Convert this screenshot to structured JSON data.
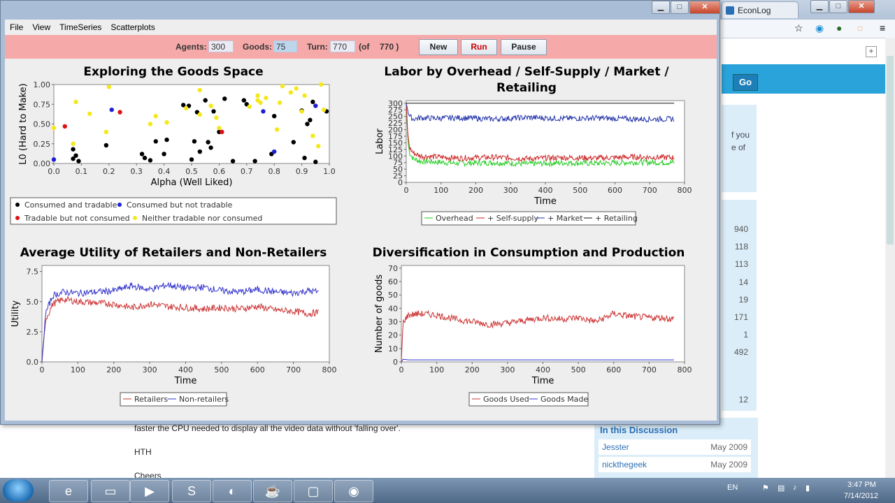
{
  "browser": {
    "tab_title": "EconLog",
    "go_label": "Go",
    "side_text_1": "f you",
    "side_text_2": "e of",
    "counts": [
      "940",
      "118",
      "113",
      "14",
      "19",
      "171",
      "1",
      "492",
      "12"
    ],
    "post_line": "faster the CPU needed to display all the video data without 'falling over'.",
    "post_hth": "HTH",
    "post_cheers": "Cheers",
    "discussion_title": "In this Discussion",
    "discussion_rows": [
      {
        "user": "Jesster",
        "date": "May 2009"
      },
      {
        "user": "nickthegeek",
        "date": "May 2009"
      }
    ]
  },
  "app": {
    "menu": [
      "File",
      "View",
      "TimeSeries",
      "Scatterplots"
    ],
    "controls": {
      "agents_label": "Agents:",
      "agents_value": "300",
      "goods_label": "Goods:",
      "goods_value": "75",
      "turn_label": "Turn:",
      "turn_value": "770",
      "of_label": "(of",
      "of_value": "770 )",
      "new_label": "New",
      "run_label": "Run",
      "pause_label": "Pause"
    },
    "colors": {
      "control_bar": "#f6a9a9",
      "run_text": "#cc0000"
    }
  },
  "taskbar": {
    "lang": "EN",
    "time": "3:47 PM",
    "date": "7/14/2012",
    "apps": [
      "ie-icon",
      "folder-icon",
      "media-player-icon",
      "skype-icon",
      "globe-icon",
      "java-icon",
      "window-icon",
      "chrome-icon"
    ]
  },
  "chart_data": [
    {
      "type": "scatter",
      "title": "Exploring the Goods Space",
      "xlabel": "Alpha (Well Liked)",
      "ylabel": "L0 (Hard to Make)",
      "xlim": [
        0,
        1.0
      ],
      "ylim": [
        0,
        1.0
      ],
      "xticks": [
        "0.0",
        "0.1",
        "0.2",
        "0.3",
        "0.4",
        "0.5",
        "0.6",
        "0.7",
        "0.8",
        "0.9",
        "1.0"
      ],
      "yticks": [
        "0.00",
        "0.25",
        "0.50",
        "0.75",
        "1.00"
      ],
      "legend_position": "bottom",
      "series": [
        {
          "name": "Consumed and tradable",
          "color": "#000000",
          "points": [
            [
              0.07,
              0.18
            ],
            [
              0.07,
              0.06
            ],
            [
              0.08,
              0.1
            ],
            [
              0.09,
              0.03
            ],
            [
              0.19,
              0.23
            ],
            [
              0.32,
              0.12
            ],
            [
              0.33,
              0.07
            ],
            [
              0.35,
              0.04
            ],
            [
              0.37,
              0.28
            ],
            [
              0.4,
              0.12
            ],
            [
              0.41,
              0.3
            ],
            [
              0.47,
              0.74
            ],
            [
              0.49,
              0.73
            ],
            [
              0.5,
              0.05
            ],
            [
              0.51,
              0.28
            ],
            [
              0.52,
              0.65
            ],
            [
              0.53,
              0.15
            ],
            [
              0.55,
              0.8
            ],
            [
              0.56,
              0.27
            ],
            [
              0.57,
              0.2
            ],
            [
              0.58,
              0.66
            ],
            [
              0.6,
              0.4
            ],
            [
              0.62,
              0.82
            ],
            [
              0.65,
              0.03
            ],
            [
              0.69,
              0.8
            ],
            [
              0.7,
              0.75
            ],
            [
              0.73,
              0.03
            ],
            [
              0.79,
              0.12
            ],
            [
              0.8,
              0.6
            ],
            [
              0.87,
              0.27
            ],
            [
              0.9,
              0.67
            ],
            [
              0.91,
              0.07
            ],
            [
              0.92,
              0.5
            ],
            [
              0.93,
              0.55
            ],
            [
              0.94,
              0.78
            ],
            [
              0.95,
              0.02
            ],
            [
              0.99,
              0.66
            ]
          ]
        },
        {
          "name": "Consumed but not tradable",
          "color": "#1f1fd6",
          "points": [
            [
              0.0,
              0.05
            ],
            [
              0.21,
              0.68
            ],
            [
              0.76,
              0.66
            ],
            [
              0.8,
              0.15
            ],
            [
              0.95,
              0.73
            ]
          ]
        },
        {
          "name": "Tradable but not consumed",
          "color": "#dd1111",
          "points": [
            [
              0.04,
              0.47
            ],
            [
              0.24,
              0.65
            ],
            [
              0.61,
              0.4
            ]
          ]
        },
        {
          "name": "Neither tradable nor consumed",
          "color": "#f5e81a",
          "points": [
            [
              0.0,
              0.45
            ],
            [
              0.07,
              0.25
            ],
            [
              0.08,
              0.78
            ],
            [
              0.13,
              0.63
            ],
            [
              0.19,
              0.4
            ],
            [
              0.2,
              0.97
            ],
            [
              0.35,
              0.5
            ],
            [
              0.37,
              0.6
            ],
            [
              0.41,
              0.52
            ],
            [
              0.48,
              0.7
            ],
            [
              0.53,
              0.93
            ],
            [
              0.53,
              0.62
            ],
            [
              0.57,
              0.73
            ],
            [
              0.59,
              0.58
            ],
            [
              0.6,
              0.45
            ],
            [
              0.71,
              0.72
            ],
            [
              0.74,
              0.8
            ],
            [
              0.74,
              0.86
            ],
            [
              0.75,
              0.77
            ],
            [
              0.77,
              0.83
            ],
            [
              0.81,
              0.43
            ],
            [
              0.82,
              0.77
            ],
            [
              0.83,
              0.98
            ],
            [
              0.86,
              0.9
            ],
            [
              0.88,
              0.95
            ],
            [
              0.9,
              0.66
            ],
            [
              0.91,
              0.86
            ],
            [
              0.94,
              0.35
            ],
            [
              0.96,
              0.22
            ],
            [
              0.97,
              1.0
            ],
            [
              0.98,
              0.68
            ]
          ]
        }
      ]
    },
    {
      "type": "line",
      "title": "Labor by Overhead / Self-Supply / Market / Retailing",
      "xlabel": "Time",
      "ylabel": "Labor",
      "xlim": [
        0,
        800
      ],
      "ylim": [
        0,
        310
      ],
      "xticks": [
        "0",
        "100",
        "200",
        "300",
        "400",
        "500",
        "600",
        "700",
        "800"
      ],
      "yticks": [
        "0",
        "25",
        "50",
        "75",
        "100",
        "125",
        "150",
        "175",
        "200",
        "225",
        "250",
        "275",
        "300"
      ],
      "legend_position": "bottom",
      "series": [
        {
          "name": "Overhead",
          "color": "#22cc22",
          "x": [
            0,
            5,
            10,
            20,
            40,
            80,
            150,
            250,
            350,
            450,
            550,
            650,
            770
          ],
          "y": [
            300,
            150,
            110,
            90,
            80,
            78,
            72,
            75,
            70,
            74,
            72,
            76,
            75
          ]
        },
        {
          "name": "+ Self-supply",
          "color": "#cc2222",
          "x": [
            0,
            5,
            10,
            20,
            40,
            80,
            150,
            250,
            350,
            450,
            550,
            650,
            770
          ],
          "y": [
            300,
            170,
            130,
            112,
            100,
            97,
            92,
            95,
            90,
            94,
            92,
            96,
            94
          ]
        },
        {
          "name": "+ Market",
          "color": "#2233aa",
          "x": [
            0,
            5,
            10,
            20,
            40,
            80,
            150,
            250,
            350,
            450,
            550,
            650,
            770
          ],
          "y": [
            300,
            270,
            250,
            240,
            245,
            243,
            245,
            240,
            246,
            242,
            244,
            240,
            240
          ]
        },
        {
          "name": "+ Retailing",
          "color": "#111111",
          "x": [
            0,
            770
          ],
          "y": [
            300,
            300
          ]
        }
      ]
    },
    {
      "type": "line",
      "title": "Average Utility of Retailers and Non-Retailers",
      "xlabel": "Time",
      "ylabel": "Utility",
      "xlim": [
        0,
        800
      ],
      "ylim": [
        0,
        8
      ],
      "xticks": [
        "0",
        "100",
        "200",
        "300",
        "400",
        "500",
        "600",
        "700",
        "800"
      ],
      "yticks": [
        "0.0",
        "2.5",
        "5.0",
        "7.5"
      ],
      "legend_position": "bottom",
      "series": [
        {
          "name": "Retailers",
          "color": "#cc3333",
          "x": [
            0,
            10,
            30,
            60,
            100,
            150,
            200,
            250,
            300,
            350,
            400,
            450,
            500,
            550,
            600,
            650,
            700,
            740,
            770
          ],
          "y": [
            0,
            3.5,
            4.8,
            5.2,
            5.0,
            4.9,
            4.8,
            4.5,
            4.8,
            4.6,
            4.5,
            4.4,
            4.5,
            4.4,
            4.6,
            4.3,
            4.2,
            4.0,
            4.1
          ]
        },
        {
          "name": "Non-retailers",
          "color": "#3333cc",
          "x": [
            0,
            10,
            30,
            60,
            100,
            150,
            200,
            250,
            300,
            350,
            400,
            450,
            500,
            550,
            600,
            650,
            700,
            740,
            770
          ],
          "y": [
            0,
            4.0,
            5.5,
            5.8,
            5.7,
            5.8,
            5.9,
            6.3,
            6.0,
            6.4,
            6.1,
            6.2,
            5.9,
            5.8,
            6.0,
            5.8,
            5.7,
            5.9,
            5.8
          ]
        }
      ]
    },
    {
      "type": "line",
      "title": "Diversification in Consumption and Production",
      "xlabel": "Time",
      "ylabel": "Number of goods",
      "xlim": [
        0,
        800
      ],
      "ylim": [
        0,
        72
      ],
      "xticks": [
        "0",
        "100",
        "200",
        "300",
        "400",
        "500",
        "600",
        "700",
        "800"
      ],
      "yticks": [
        "0",
        "10",
        "20",
        "30",
        "40",
        "50",
        "60",
        "70"
      ],
      "legend_position": "bottom",
      "series": [
        {
          "name": "Goods Used",
          "color": "#cc3333",
          "x": [
            0,
            5,
            20,
            50,
            100,
            150,
            200,
            250,
            300,
            350,
            400,
            450,
            500,
            550,
            600,
            650,
            700,
            740,
            770
          ],
          "y": [
            0,
            30,
            35,
            36,
            35,
            32,
            30,
            28,
            29,
            31,
            33,
            32,
            33,
            30,
            36,
            34,
            33,
            33,
            32
          ]
        },
        {
          "name": "Goods Made",
          "color": "#3333cc",
          "x": [
            0,
            5,
            20,
            100,
            300,
            500,
            700,
            770
          ],
          "y": [
            0,
            2,
            1.5,
            1.5,
            1.5,
            1.5,
            1.5,
            1.5
          ]
        }
      ]
    }
  ]
}
